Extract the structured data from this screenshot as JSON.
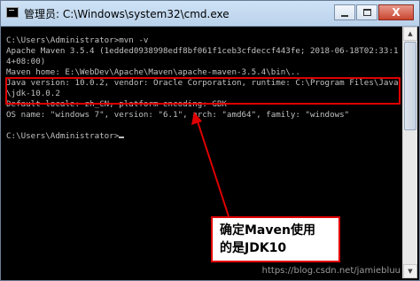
{
  "window": {
    "title": "管理员: C:\\Windows\\system32\\cmd.exe",
    "app_icon": "cmd-icon",
    "controls": {
      "minimize_icon": "minimize-icon",
      "maximize_icon": "maximize-icon",
      "close_icon": "close-icon",
      "close_glyph": "X"
    }
  },
  "console": {
    "lines": [
      "C:\\Users\\Administrator>mvn -v",
      "Apache Maven 3.5.4 (1edded0938998edf8bf061f1ceb3cfdeccf443fe; 2018-06-18T02:33:1",
      "4+08:00)",
      "Maven home: E:\\WebDev\\Apache\\Maven\\apache-maven-3.5.4\\bin\\..",
      "Java version: 10.0.2, vendor: Oracle Corporation, runtime: C:\\Program Files\\Java",
      "\\jdk-10.0.2",
      "Default locale: zh_CN, platform encoding: GBK",
      "OS name: \"windows 7\", version: \"6.1\", arch: \"amd64\", family: \"windows\"",
      "",
      "C:\\Users\\Administrator>"
    ],
    "text_color": "#c0c0c0",
    "background_color": "#000000"
  },
  "annotation": {
    "callout_line1": "确定Maven使用",
    "callout_line2": "的是JDK10",
    "color": "#e00000"
  },
  "scrollbar": {
    "up_icon": "scroll-up-arrow-icon",
    "down_icon": "scroll-down-arrow-icon"
  },
  "watermark": "https://blog.csdn.net/jamiebluu"
}
